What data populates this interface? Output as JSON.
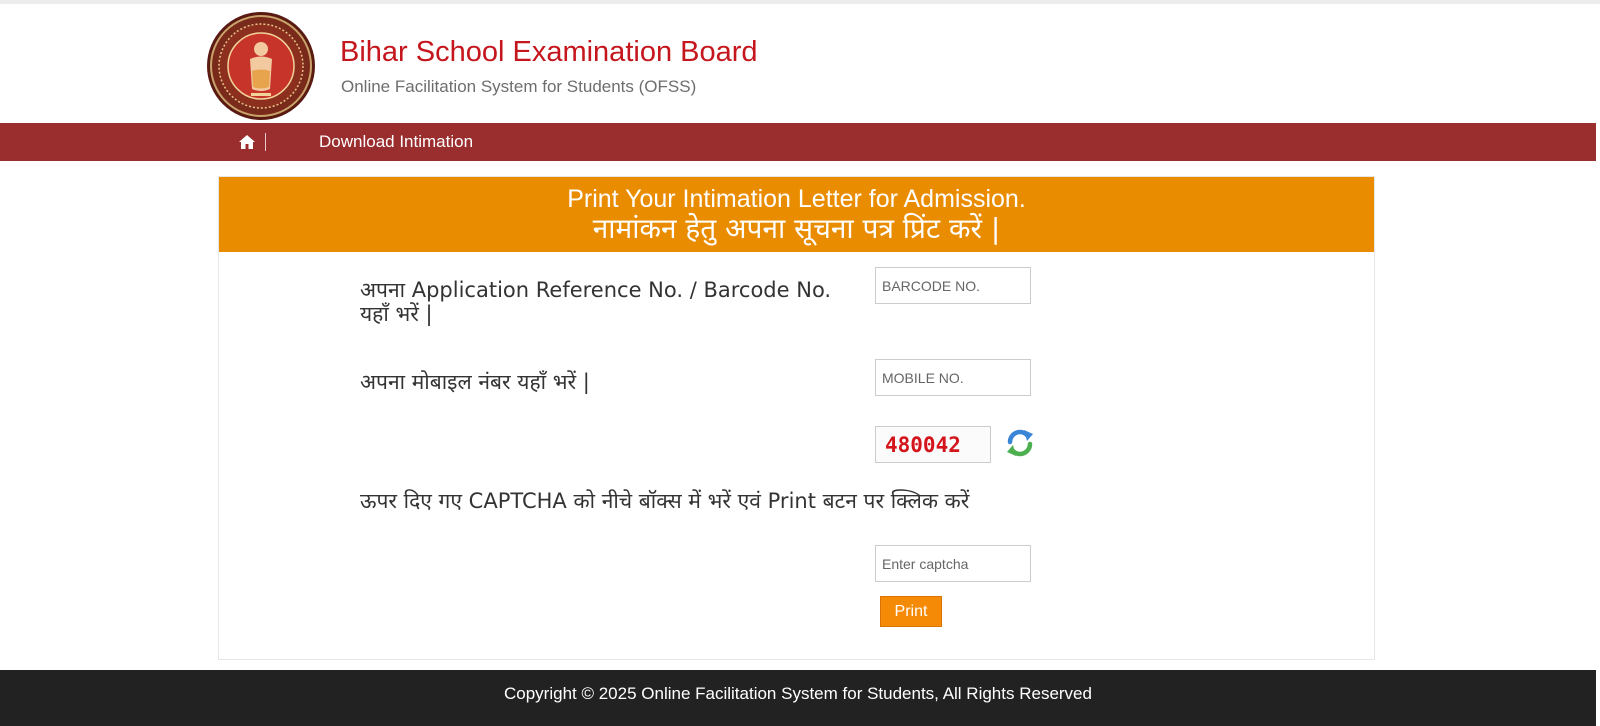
{
  "header": {
    "title": "Bihar School Examination Board",
    "subtitle": "Online Facilitation System for Students (OFSS)",
    "logo_icon": "bseb-emblem-icon"
  },
  "nav": {
    "home_icon": "home-icon",
    "items": [
      {
        "label": "Download Intimation"
      }
    ]
  },
  "panel": {
    "heading_en": "Print Your Intimation Letter for Admission.",
    "heading_hi": "नामांकन हेतु अपना सूचना पत्र प्रिंट करें |"
  },
  "form": {
    "barcode_label": "अपना Application Reference No. / Barcode No. यहाँ भरें |",
    "barcode_placeholder": "BARCODE NO.",
    "mobile_label": "अपना मोबाइल नंबर यहाँ भरें |",
    "mobile_placeholder": "MOBILE NO.",
    "captcha_code": "480042",
    "refresh_icon": "refresh-icon",
    "captcha_label": "ऊपर दिए गए CAPTCHA को नीचे बॉक्स में भरें एवं Print बटन पर क्लिक करें",
    "captcha_placeholder": "Enter captcha",
    "print_label": "Print"
  },
  "footer": {
    "copyright": "Copyright © 2025 Online Facilitation System for Students, All Rights Reserved"
  },
  "colors": {
    "title_red": "#c4161c",
    "navbar": "#9a2d2e",
    "panel_heading": "#ea8c00",
    "print_button": "#f58a07",
    "footer": "#222222",
    "captcha_text": "#d4141b"
  }
}
